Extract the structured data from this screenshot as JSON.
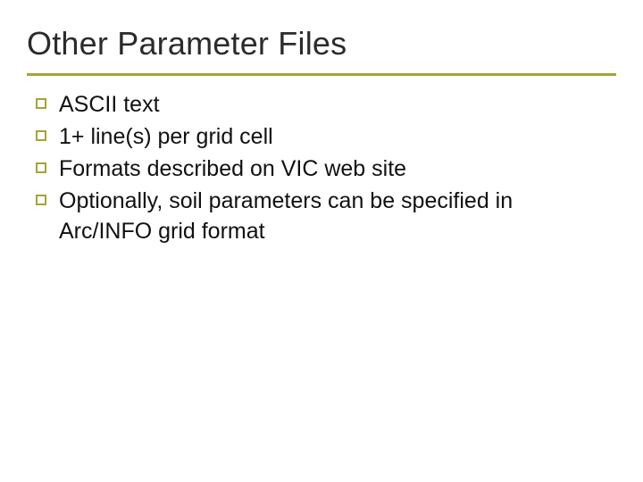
{
  "title": "Other Parameter Files",
  "bullets": [
    "ASCII text",
    "1+ line(s) per grid cell",
    "Formats described on VIC web site",
    "Optionally, soil parameters can be specified in Arc/INFO grid format"
  ],
  "colors": {
    "accent": "#a6a23a"
  }
}
